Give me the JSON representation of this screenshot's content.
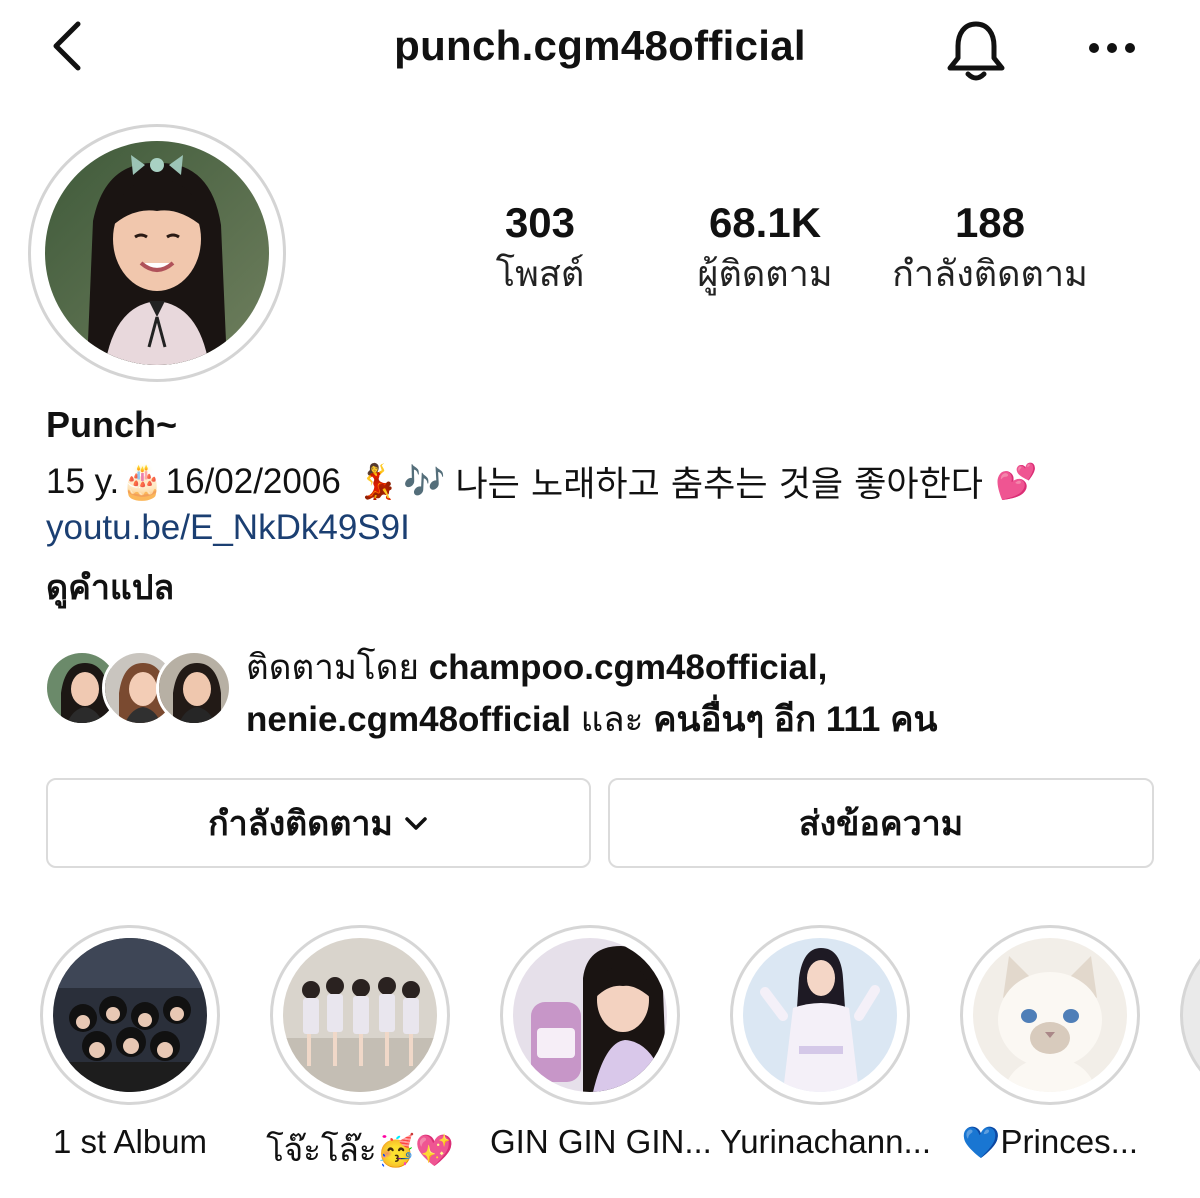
{
  "header": {
    "username": "punch.cgm48official",
    "back_icon": "chevron-left-icon",
    "bell_icon": "bell-icon",
    "more_icon": "more-horizontal-icon"
  },
  "stats": [
    {
      "value": "303",
      "label": "โพสต์"
    },
    {
      "value": "68.1K",
      "label": "ผู้ติดตาม"
    },
    {
      "value": "188",
      "label": "กำลังติดตาม"
    }
  ],
  "bio": {
    "display_name": "Punch~",
    "age_text": "15 y.",
    "cake_emoji": "🎂",
    "birthdate": "16/02/2006",
    "dancer_emoji": "💃",
    "notes_emoji": "🎶",
    "korean_text": "나는 노래하고 춤추는 것을 좋아한다",
    "hearts_emoji": "💕",
    "link": "youtu.be/E_NkDk49S9I",
    "see_translation": "ดูคำแปล"
  },
  "followed_by": {
    "prefix": "ติดตามโดย",
    "user1": "champoo.cgm48official,",
    "user2": "nenie.cgm48official",
    "and": "และ",
    "others": "คนอื่นๆ อีก 111 คน"
  },
  "buttons": {
    "following": "กำลังติดตาม",
    "message": "ส่งข้อความ"
  },
  "highlights": [
    {
      "label": "1 st Album"
    },
    {
      "label": "โจ๊ะโล๊ะ",
      "emoji": "🥳💖"
    },
    {
      "label": "GIN GIN GIN..."
    },
    {
      "label": "Yurinachann..."
    },
    {
      "label": "Princes...",
      "emoji_prefix": "💙"
    }
  ],
  "colors": {
    "link": "#1b3f72",
    "border": "#dbdbdb",
    "ring": "#d4d4d4"
  }
}
